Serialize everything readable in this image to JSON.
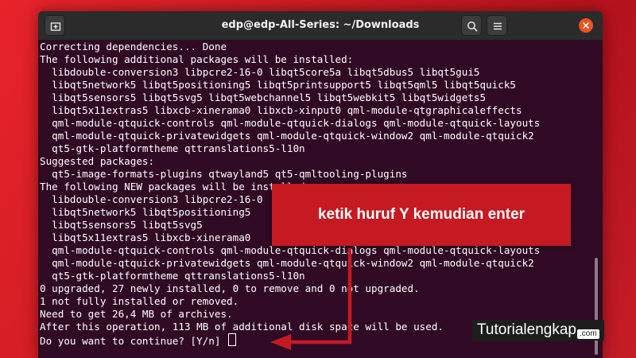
{
  "window": {
    "title": "edp@edp-All-Series: ~/Downloads"
  },
  "titlebar": {
    "new_tab_icon": "new-tab-icon",
    "search_icon": "search-icon",
    "menu_icon": "hamburger-menu-icon",
    "close_icon": "close-icon"
  },
  "terminal": {
    "lines": [
      "Correcting dependencies... Done",
      "The following additional packages will be installed:",
      "  libdouble-conversion3 libpcre2-16-0 libqt5core5a libqt5dbus5 libqt5gui5",
      "  libqt5network5 libqt5positioning5 libqt5printsupport5 libqt5qml5 libqt5quick5",
      "  libqt5sensors5 libqt5svg5 libqt5webchannel5 libqt5webkit5 libqt5widgets5",
      "  libqt5x11extras5 libxcb-xinerama0 libxcb-xinput0 qml-module-qtgraphicaleffects",
      "  qml-module-qtquick-controls qml-module-qtquick-dialogs qml-module-qtquick-layouts",
      "  qml-module-qtquick-privatewidgets qml-module-qtquick-window2 qml-module-qtquick2",
      "  qt5-gtk-platformtheme qttranslations5-l10n",
      "Suggested packages:",
      "  qt5-image-formats-plugins qtwayland5 qt5-qmltooling-plugins",
      "The following NEW packages will be installed:",
      "  libdouble-conversion3 libpcre2-16-0",
      "  libqt5network5 libqt5positioning5",
      "  libqt5sensors5 libqt5svg5",
      "  libqt5x11extras5 libxcb-xinerama0",
      "  qml-module-qtquick-controls qml-module-qtquick-dialogs qml-module-qtquick-layouts",
      "  qml-module-qtquick-privatewidgets qml-module-qtquick-window2 qml-module-qtquick2",
      "  qt5-gtk-platformtheme qttranslations5-l10n",
      "0 upgraded, 27 newly installed, 0 to remove and 0 not upgraded.",
      "1 not fully installed or removed.",
      "Need to get 26,4 MB of archives.",
      "After this operation, 113 MB of additional disk space will be used."
    ],
    "prompt": "Do you want to continue? [Y/n] "
  },
  "annotation": {
    "callout_text": "ketik huruf Y kemudian enter",
    "color": "#c51a22"
  },
  "watermark": {
    "name": "Tutorialengkap",
    "tld": ".com"
  },
  "colors": {
    "terminal_bg": "#300a24",
    "titlebar_bg": "#2b2b2b",
    "close_button": "#e95420",
    "background_red": "#d8202a"
  }
}
